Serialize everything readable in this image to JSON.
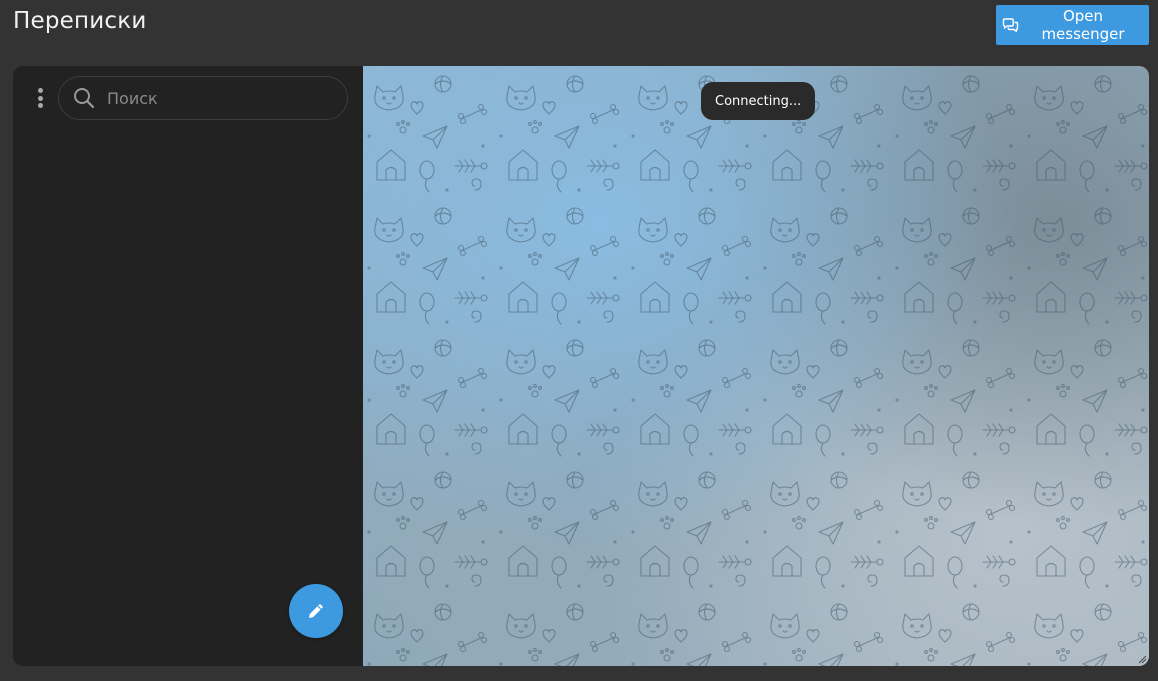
{
  "header": {
    "title": "Переписки",
    "open_button_label": "Open messenger"
  },
  "sidebar": {
    "search": {
      "placeholder": "Поиск",
      "value": ""
    }
  },
  "chat": {
    "status_toast": "Connecting..."
  },
  "icons": {
    "menu": "vertical-dots-icon",
    "search": "search-icon",
    "compose": "pencil-icon",
    "messenger": "chat-bubbles-icon"
  },
  "colors": {
    "accent": "#3d9ae0",
    "page_background": "#333333",
    "sidebar_background": "#222222",
    "toast_background": "#2a2a2a"
  }
}
